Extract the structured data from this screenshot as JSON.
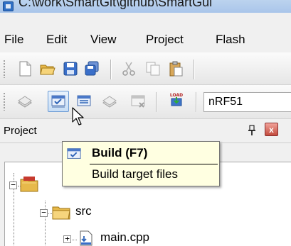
{
  "window": {
    "title": "C:\\work\\SmartGit\\github\\SmartGul"
  },
  "menu": [
    "File",
    "Edit",
    "View",
    "Project",
    "Flash"
  ],
  "toolbar2": {
    "load_label": "LOAD",
    "target_value": "nRF51"
  },
  "project_pane": {
    "title": "Project",
    "close_label": "x",
    "tree": [
      {
        "label": "",
        "kind": "target",
        "expander": "−"
      },
      {
        "label": "src",
        "kind": "folder",
        "expander": "−"
      },
      {
        "label": "main.cpp",
        "kind": "file",
        "expander": "+"
      }
    ]
  },
  "tooltip": {
    "title": "Build (F7)",
    "description": "Build target files"
  },
  "colors": {
    "tooltip_bg": "#ffffe1",
    "hover_border": "#6a9ad4",
    "folder": "#e7b94a"
  }
}
